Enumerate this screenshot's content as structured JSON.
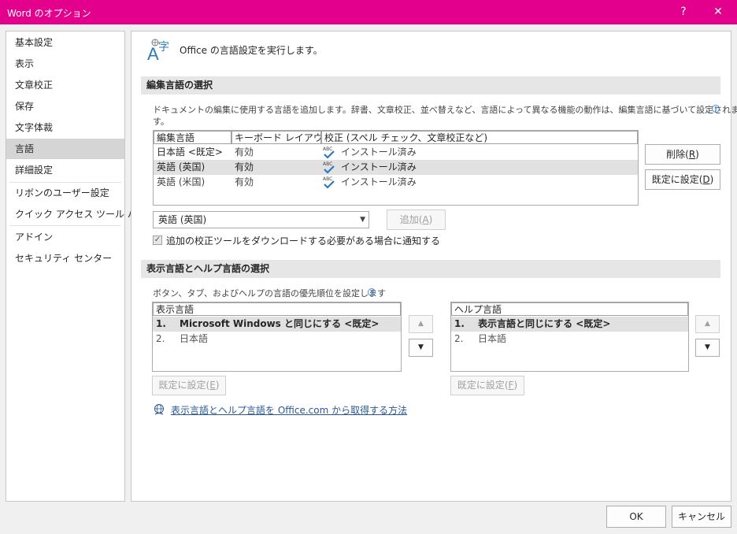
{
  "window": {
    "title": "Word のオプション",
    "help_label": "?",
    "close_label": "✕",
    "accent_color": "#e3008c"
  },
  "sidebar": {
    "items": [
      {
        "label": "基本設定"
      },
      {
        "label": "表示"
      },
      {
        "label": "文章校正"
      },
      {
        "label": "保存"
      },
      {
        "label": "文字体裁"
      },
      {
        "label": "言語",
        "selected": true
      },
      {
        "label": "詳細設定"
      },
      {
        "label": "リボンのユーザー設定"
      },
      {
        "label": "クイック アクセス ツール バー"
      },
      {
        "label": "アドイン"
      },
      {
        "label": "セキュリティ センター"
      }
    ]
  },
  "main": {
    "header_icon": "language-icon",
    "header_text": "Office の言語設定を実行します。",
    "editing": {
      "section_title": "編集言語の選択",
      "description": "ドキュメントの編集に使用する言語を追加します。辞書、文章校正、並べ替えなど、言語によって異なる機能の動作は、編集言語に基づいて設定されま",
      "description_line2": "す。",
      "columns": [
        "編集言語",
        "キーボード レイアウト",
        "校正 (スペル チェック、文章校正など)"
      ],
      "rows": [
        {
          "language": "日本語 <既定>",
          "keyboard": "有効",
          "proofing": "インストール済み",
          "selected": false
        },
        {
          "language": "英語 (英国)",
          "keyboard": "有効",
          "proofing": "インストール済み",
          "selected": true
        },
        {
          "language": "英語 (米国)",
          "keyboard": "有効",
          "proofing": "インストール済み",
          "selected": false
        }
      ],
      "remove_button": "削除(",
      "remove_key": "R",
      "set_default_button": "既定に設定(",
      "set_default_key": "D",
      "dropdown_value": "英語 (英国)",
      "add_button": "追加(",
      "add_key": "A",
      "checkbox_label": "追加の校正ツールをダウンロードする必要がある場合に通知する",
      "checkbox_checked": true
    },
    "display": {
      "section_title": "表示言語とヘルプ言語の選択",
      "description": "ボタン、タブ、およびヘルプの言語の優先順位を設定します",
      "display_list": {
        "header": "表示言語",
        "items": [
          {
            "num": "1.",
            "label": "Microsoft Windows と同じにする <既定>",
            "selected": true
          },
          {
            "num": "2.",
            "label": "日本語",
            "selected": false
          }
        ]
      },
      "help_list": {
        "header": "ヘルプ言語",
        "items": [
          {
            "num": "1.",
            "label": "表示言語と同じにする <既定>",
            "selected": true
          },
          {
            "num": "2.",
            "label": "日本語",
            "selected": false
          }
        ]
      },
      "set_default_display": "既定に設定(",
      "set_default_display_key": "E",
      "set_default_help": "既定に設定(",
      "set_default_help_key": "F",
      "link_text": "表示言語とヘルプ言語を Office.com から取得する方法"
    }
  },
  "footer": {
    "ok_button": "OK",
    "cancel_button": "キャンセル"
  }
}
